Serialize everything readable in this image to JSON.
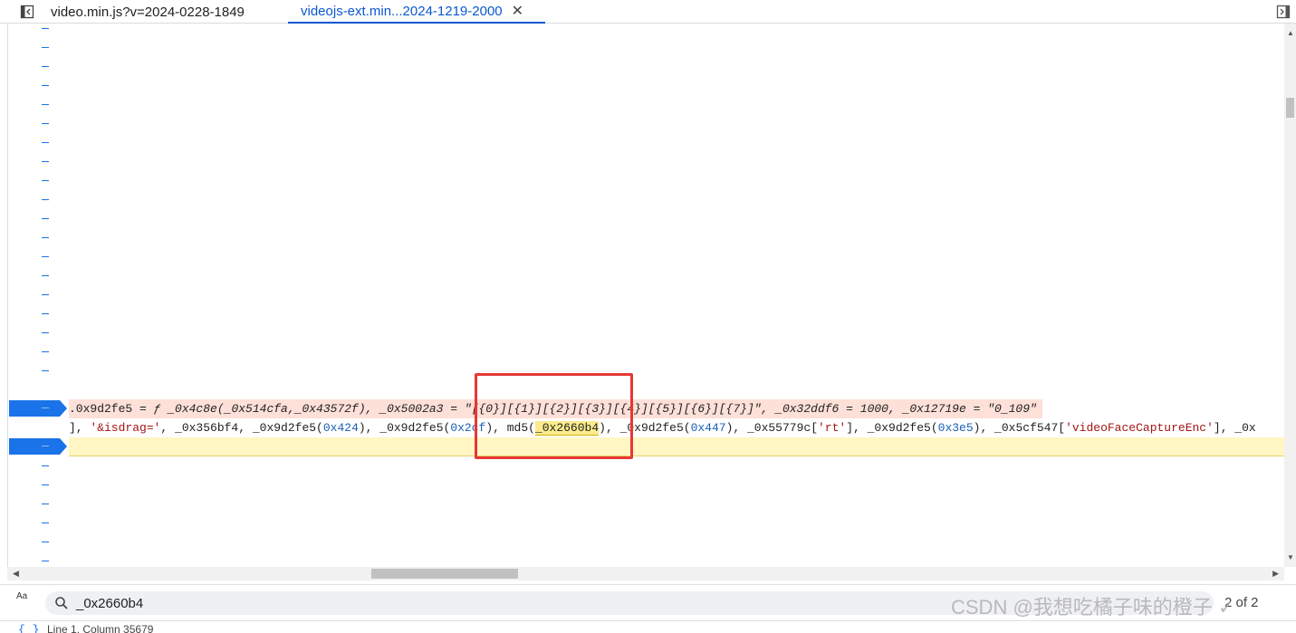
{
  "tabs": [
    {
      "label": "video.min.js?v=2024-0228-1849",
      "active": false
    },
    {
      "label": "videojs-ext.min...2024-1219-2000",
      "active": true
    }
  ],
  "tab_close_glyph": "✕",
  "gutter_marker": "–",
  "code": {
    "line_a": {
      "t1": ".0x9d2fe5 = ",
      "t2": "ƒ _0x4c8e(_0x514cfa,_0x43572f), _0x5002a3 = ",
      "t3": "\"[{0}][{1}][{2}][{3}][{4}][{5}][{6}][{7}]\"",
      "t4": ", _0x32ddf6 = 1000, _0x12719e = ",
      "t5": "\"0_109\""
    },
    "line_b": {
      "p1": "], ",
      "s1": "'&isdrag='",
      "p2": ", _0x356bf4, _0x9d2fe5(",
      "h1": "0x424",
      "p3": "), _0x9d2fe5(",
      "h2": "0x2cf",
      "p4": "), md5(",
      "m1": "_0x2660b4",
      "p5": "), _0x9d2fe5(",
      "h3": "0x447",
      "p6": "), _0x55779c[",
      "s2": "'rt'",
      "p7": "], _0x9d2fe5(",
      "h4": "0x3e5",
      "p8": "), _0x5cf547[",
      "s3": "'videoFaceCaptureEnc'",
      "p9": "], _0x"
    }
  },
  "search": {
    "value": "_0x2660b4",
    "match_count": "2 of 2",
    "case_button_label": "Aa"
  },
  "status": {
    "position": "Line 1, Column 35679"
  },
  "watermark": "CSDN @我想吃橘子味的橙子 ✓",
  "colors": {
    "accent": "#0b57d0",
    "breakpoint": "#1a73e8",
    "highlight_red": "#e53935",
    "paused_line": "#fff6c4",
    "evaluated_line": "#fde0d8"
  }
}
